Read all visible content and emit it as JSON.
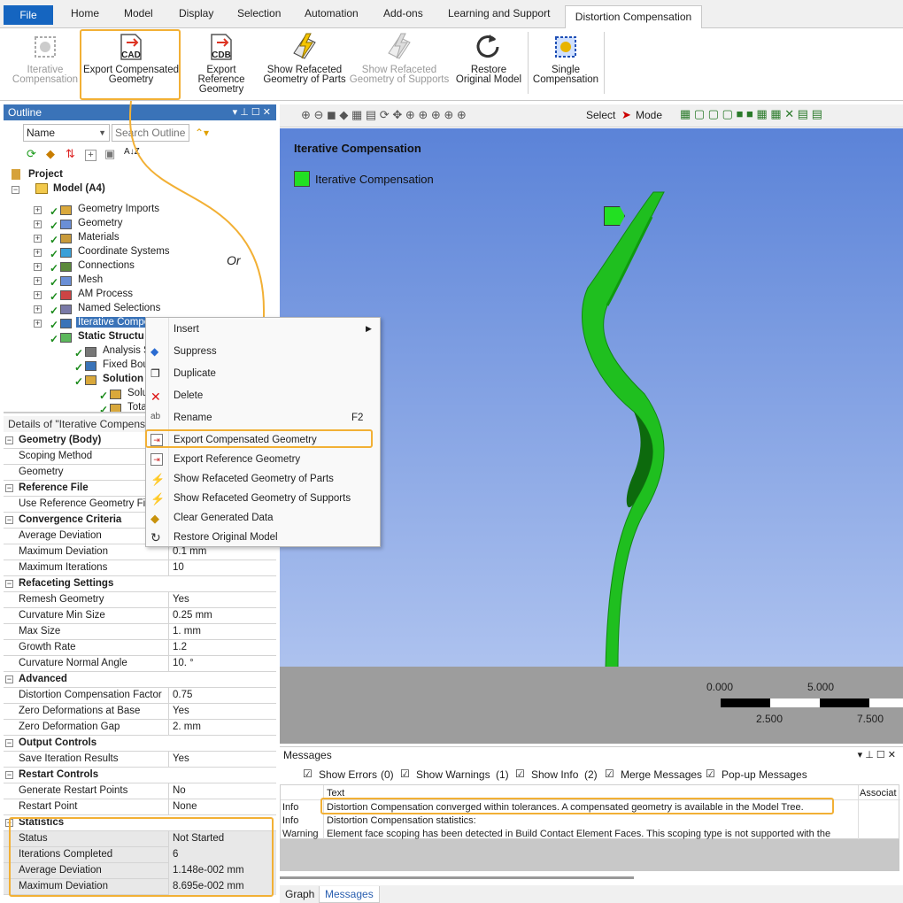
{
  "tabs": {
    "file": "File",
    "home": "Home",
    "model": "Model",
    "display": "Display",
    "selection": "Selection",
    "automation": "Automation",
    "addons": "Add-ons",
    "learning": "Learning and Support",
    "active": "Distortion Compensation"
  },
  "ribbon": {
    "iterative_l1": "Iterative",
    "iterative_l2": "Compensation",
    "exp_comp_l1": "Export Compensated",
    "exp_comp_l2": "Geometry",
    "exp_ref_l1": "Export Reference",
    "exp_ref_l2": "Geometry",
    "show_parts_l1": "Show Refaceted",
    "show_parts_l2": "Geometry of Parts",
    "show_supports_l1": "Show Refaceted",
    "show_supports_l2": "Geometry of Supports",
    "restore_l1": "Restore",
    "restore_l2": "Original Model",
    "single_l1": "Single",
    "single_l2": "Compensation",
    "cad_tag": "CAD",
    "cdb_tag": "CDB"
  },
  "annotation": {
    "or": "Or"
  },
  "outline": {
    "title": "Outline",
    "name_filter": "Name",
    "search_placeholder": "Search Outline",
    "sort_glyph": "A↓Z",
    "tree": {
      "project": "Project",
      "model": "Model (A4)",
      "geometry_imports": "Geometry Imports",
      "geometry": "Geometry",
      "materials": "Materials",
      "coordinate_systems": "Coordinate Systems",
      "connections": "Connections",
      "mesh": "Mesh",
      "am_process": "AM Process",
      "named_selections": "Named Selections",
      "iterative_comp": "Iterative Compensation",
      "static_structural": "Static Structu",
      "analysis_settings": "Analysis Se",
      "fixed_boundary": "Fixed Bour",
      "solution": "Solution",
      "solution_info": "Solut",
      "total": "Tota"
    }
  },
  "details": {
    "title": "Details of \"Iterative Compens",
    "rows": [
      {
        "k": "Geometry (Body)",
        "v": "",
        "grp": true
      },
      {
        "k": "Scoping Method",
        "v": ""
      },
      {
        "k": "Geometry",
        "v": ""
      },
      {
        "k": "Reference File",
        "v": "",
        "grp": true
      },
      {
        "k": "Use Reference Geometry File",
        "v": ""
      },
      {
        "k": "Convergence Criteria",
        "v": "",
        "grp": true
      },
      {
        "k": "Average Deviation",
        "v": ""
      },
      {
        "k": "Maximum Deviation",
        "v": "0.1 mm"
      },
      {
        "k": "Maximum Iterations",
        "v": "10"
      },
      {
        "k": "Refaceting Settings",
        "v": "",
        "grp": true
      },
      {
        "k": "Remesh Geometry",
        "v": "Yes"
      },
      {
        "k": "Curvature Min Size",
        "v": "0.25 mm"
      },
      {
        "k": "Max Size",
        "v": "1. mm"
      },
      {
        "k": "Growth Rate",
        "v": "1.2"
      },
      {
        "k": "Curvature Normal Angle",
        "v": "10. °"
      },
      {
        "k": "Advanced",
        "v": "",
        "grp": true
      },
      {
        "k": "Distortion Compensation Factor",
        "v": "0.75"
      },
      {
        "k": "Zero Deformations at Base",
        "v": "Yes"
      },
      {
        "k": "Zero Deformation Gap",
        "v": "2. mm"
      },
      {
        "k": "Output Controls",
        "v": "",
        "grp": true
      },
      {
        "k": "Save Iteration Results",
        "v": "Yes"
      },
      {
        "k": "Restart Controls",
        "v": "",
        "grp": true
      },
      {
        "k": "Generate Restart Points",
        "v": "No"
      },
      {
        "k": "Restart Point",
        "v": "None"
      },
      {
        "k": "Statistics",
        "v": "",
        "grp": true
      },
      {
        "k": "Status",
        "v": "Not Started"
      },
      {
        "k": "Iterations Completed",
        "v": "6"
      },
      {
        "k": "Average Deviation",
        "v": "1.148e-002 mm"
      },
      {
        "k": "Maximum Deviation",
        "v": "8.695e-002 mm"
      }
    ]
  },
  "context_menu": {
    "insert": "Insert",
    "suppress": "Suppress",
    "duplicate": "Duplicate",
    "delete": "Delete",
    "rename": "Rename",
    "rename_shortcut": "F2",
    "export_comp": "Export Compensated Geometry",
    "export_ref": "Export Reference Geometry",
    "show_parts": "Show Refaceted Geometry of Parts",
    "show_supports": "Show Refaceted Geometry of Supports",
    "clear": "Clear Generated Data",
    "restore": "Restore Original Model"
  },
  "toolbar": {
    "select": "Select",
    "mode": "Mode"
  },
  "viewport": {
    "title": "Iterative Compensation",
    "legend": "Iterative Compensation",
    "scale_0": "0.000",
    "scale_5": "5.000",
    "scale_25": "2.500",
    "scale_75": "7.500"
  },
  "messages": {
    "title": "Messages",
    "show_errors": "Show Errors",
    "errors_count": "(0)",
    "show_warnings": "Show Warnings",
    "warnings_count": "(1)",
    "show_info": "Show Info",
    "info_count": "(2)",
    "merge": "Merge Messages",
    "popup": "Pop-up Messages",
    "col_text": "Text",
    "col_assoc": "Associat",
    "rows": [
      {
        "type": "Info",
        "text": "Distortion Compensation converged within tolerances. A compensated geometry is available in the Model Tree."
      },
      {
        "type": "Info",
        "text": "Distortion Compensation statistics:"
      },
      {
        "type": "Warning",
        "text": "Element face scoping has been detected in Build Contact Element Faces. This scoping type is not supported with the"
      }
    ]
  },
  "bottom_tabs": {
    "graph": "Graph",
    "messages": "Messages"
  },
  "colors": {
    "accent": "#3a73b8",
    "highlight": "#f2b035",
    "part": "#22c422"
  }
}
